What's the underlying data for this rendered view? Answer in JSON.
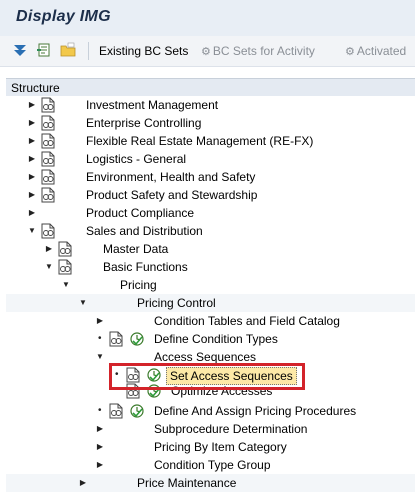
{
  "window": {
    "title": "Display IMG"
  },
  "toolbar": {
    "existing_bc_sets": "Existing BC Sets",
    "bc_sets_for_activity": "BC Sets for Activity",
    "activated": "Activated"
  },
  "structure": {
    "header": "Structure"
  },
  "tree": {
    "investment_management": "Investment Management",
    "enterprise_controlling": "Enterprise Controlling",
    "flexible_real_estate": "Flexible Real Estate Management (RE-FX)",
    "logistics_general": "Logistics - General",
    "environment_health_safety": "Environment, Health and Safety",
    "product_safety": "Product Safety and Stewardship",
    "product_compliance": "Product Compliance",
    "sales_distribution": "Sales and Distribution",
    "master_data": "Master Data",
    "basic_functions": "Basic Functions",
    "pricing": "Pricing",
    "pricing_control": "Pricing Control",
    "condition_tables": "Condition Tables and Field Catalog",
    "define_condition_types": "Define Condition Types",
    "access_sequences": "Access Sequences",
    "set_access_sequences": "Set Access Sequences",
    "optimize_accesses": "Optimize Accesses",
    "define_assign_pricing": "Define And Assign Pricing Procedures",
    "subprocedure_determination": "Subprocedure Determination",
    "pricing_by_item_category": "Pricing By Item Category",
    "condition_type_group": "Condition Type Group",
    "price_maintenance": "Price Maintenance"
  },
  "colors": {
    "highlight": "#fde9a7",
    "annotation_box": "#d3232a",
    "title_text": "#1c2e4a"
  }
}
